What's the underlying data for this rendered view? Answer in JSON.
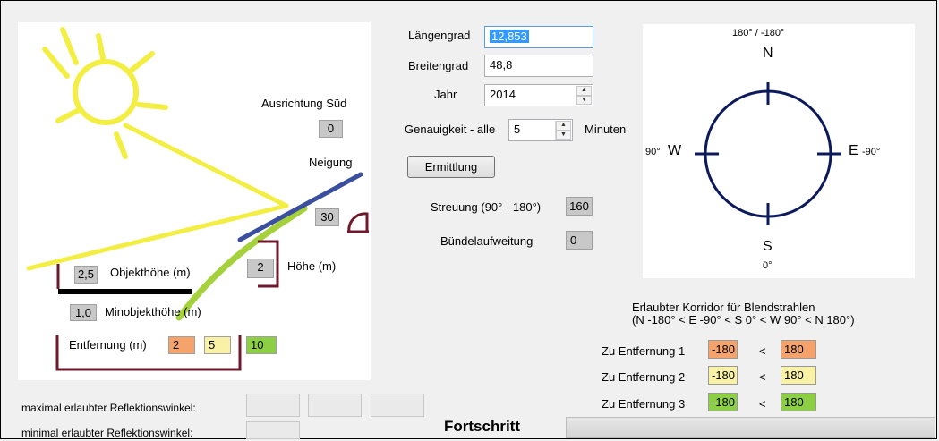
{
  "colors": {
    "orange": "#f5a36b",
    "yellow": "#f8f1a6",
    "green": "#8ccf45",
    "sun": "#f2ee43",
    "blue": "#3a4f9e",
    "maroon": "#6e1a2c",
    "grey_box": "#c8c8c8"
  },
  "diagram": {
    "ausrichtung_label": "Ausrichtung Süd",
    "ausrichtung_value": "0",
    "neigung_label": "Neigung",
    "neigung_value": "30",
    "objekthoehe_value": "2,5",
    "objekthoehe_label": "Objekthöhe (m)",
    "hoehe_value": "2",
    "hoehe_label": "Höhe (m)",
    "minobjekthoehe_value": "1,0",
    "minobjekthoehe_label": "Minobjekthöhe (m)",
    "entfernung_label": "Entfernung (m)",
    "entfernung_values": [
      "2",
      "5",
      "10"
    ]
  },
  "inputs": {
    "laengengrad_label": "Längengrad",
    "laengengrad_value": "12,853",
    "breitengrad_label": "Breitengrad",
    "breitengrad_value": "48,8",
    "jahr_label": "Jahr",
    "jahr_value": "2014",
    "genauigkeit_label": "Genauigkeit - alle",
    "genauigkeit_value": "5",
    "minuten_label": "Minuten",
    "ermittlung_button": "Ermittlung",
    "streuung_label": "Streuung (90° - 180°)",
    "streuung_value": "160",
    "buendel_label": "Bündelaufweitung",
    "buendel_value": "0"
  },
  "compass": {
    "top_label": "180° / -180°",
    "n": "N",
    "s": "S",
    "w": "W",
    "e": "E",
    "w_deg": "90°",
    "e_deg": "-90°",
    "s_deg": "0°"
  },
  "corridor": {
    "title_line1": "Erlaubter Korridor für Blendstrahlen",
    "title_line2": "(N -180° < E -90° < S 0° < W 90° < N 180°)",
    "rows": [
      {
        "label": "Zu Entfernung 1",
        "min": "-180",
        "lt": "<",
        "max": "180"
      },
      {
        "label": "Zu Entfernung 2",
        "min": "-180",
        "lt": "<",
        "max": "180"
      },
      {
        "label": "Zu Entfernung 3",
        "min": "-180",
        "lt": "<",
        "max": "180"
      }
    ]
  },
  "bottom": {
    "max_label": "maximal erlaubter Reflektionswinkel:",
    "min_label": "minimal erlaubter Reflektionswinkel:",
    "fortschritt_label": "Fortschritt",
    "progress": 0
  }
}
